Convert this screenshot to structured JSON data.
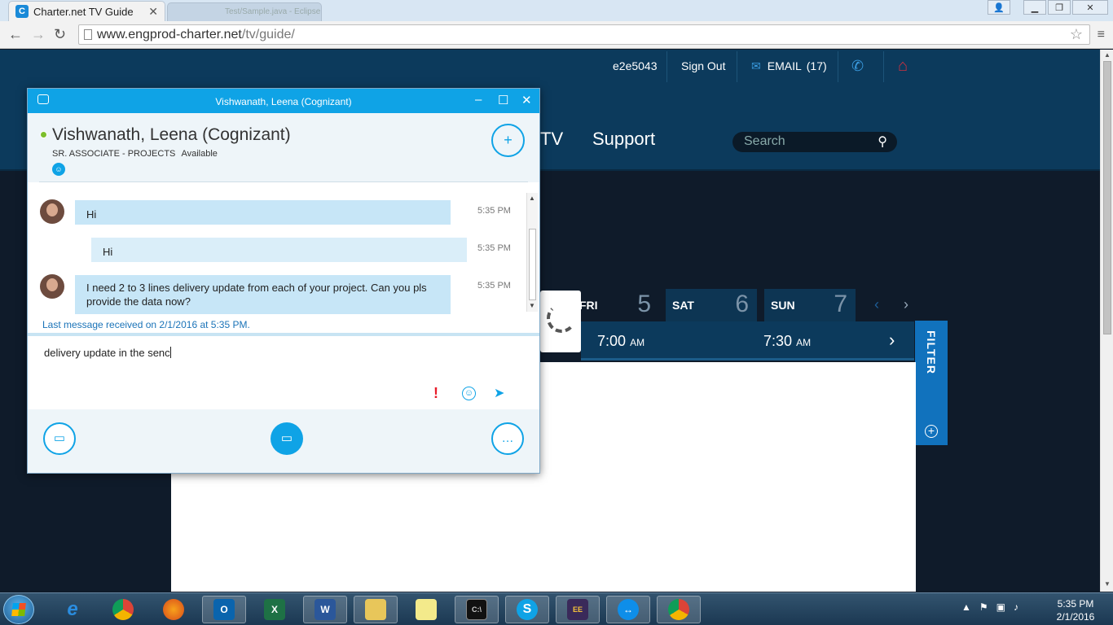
{
  "browser": {
    "tab_title": "Charter.net TV Guide",
    "tab_favicon": "C",
    "tab_close": "✕",
    "background_tab_title": "Test/Sample.java - Eclipse",
    "url_host": "www.engprod-charter.net",
    "url_path": "/tv/guide/"
  },
  "site": {
    "utility": {
      "username": "e2e5043",
      "sign_out": "Sign Out",
      "email_label": "EMAIL",
      "email_count": "(17)"
    },
    "nav": {
      "tv_partial": "TV",
      "support": "Support"
    },
    "search_placeholder": "Search",
    "days": [
      {
        "name": "FRI",
        "date": "5"
      },
      {
        "name": "SAT",
        "date": "6"
      },
      {
        "name": "SUN",
        "date": "7"
      }
    ],
    "times": [
      {
        "time": "7:00",
        "ampm": "AM"
      },
      {
        "time": "7:30",
        "ampm": "AM"
      }
    ],
    "filter_label": "FILTER"
  },
  "skype": {
    "window_title": "Vishwanath, Leena (Cognizant)",
    "contact_name": "Vishwanath, Leena (Cognizant)",
    "contact_role": "SR. ASSOCIATE - PROJECTS",
    "contact_status": "Available",
    "messages": [
      {
        "text": "Hi",
        "time": "5:35 PM",
        "direction": "in"
      },
      {
        "text": "Hi",
        "time": "5:35 PM",
        "direction": "out"
      },
      {
        "text": "I need 2 to 3 lines delivery update from each of your project. Can you pls provide the data now?",
        "time": "5:35 PM",
        "direction": "in"
      }
    ],
    "last_message": "Last message received on 2/1/2016 at 5:35 PM.",
    "compose_text": "delivery update in the senc"
  },
  "taskbar": {
    "items": [
      "Internet Explorer",
      "Google Chrome",
      "Firefox",
      "Outlook",
      "Excel",
      "Word",
      "File Explorer",
      "Sticky Notes",
      "Command Prompt",
      "Skype for Business",
      "Java EE IDE",
      "TeamViewer",
      "Google Chrome"
    ],
    "time": "5:35 PM",
    "date": "2/1/2016"
  },
  "colors": {
    "skype_blue": "#0fa3e6",
    "header_blue": "#0c3a5c",
    "filter_blue": "#1172bd",
    "presence_green": "#7cbf2c",
    "urgent_red": "#e81c2a"
  }
}
